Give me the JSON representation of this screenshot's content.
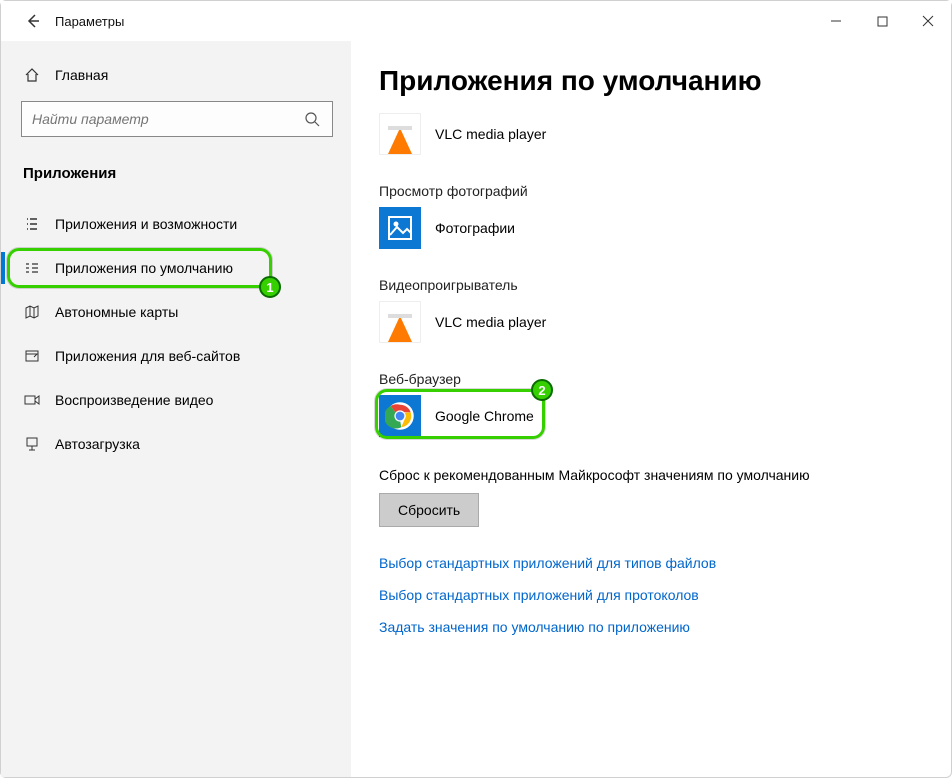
{
  "titlebar": {
    "title": "Параметры"
  },
  "sidebar": {
    "home": "Главная",
    "search_placeholder": "Найти параметр",
    "section": "Приложения",
    "items": [
      {
        "label": "Приложения и возможности"
      },
      {
        "label": "Приложения по умолчанию"
      },
      {
        "label": "Автономные карты"
      },
      {
        "label": "Приложения для веб-сайтов"
      },
      {
        "label": "Воспроизведение видео"
      },
      {
        "label": "Автозагрузка"
      }
    ]
  },
  "main": {
    "heading": "Приложения по умолчанию",
    "defaults": [
      {
        "category": "",
        "app": "VLC media player",
        "icon": "vlc"
      },
      {
        "category": "Просмотр фотографий",
        "app": "Фотографии",
        "icon": "photos"
      },
      {
        "category": "Видеопроигрыватель",
        "app": "VLC media player",
        "icon": "vlc"
      },
      {
        "category": "Веб-браузер",
        "app": "Google Chrome",
        "icon": "chrome"
      }
    ],
    "reset": {
      "label": "Сброс к рекомендованным Майкрософт значениям по умолчанию",
      "button": "Сбросить"
    },
    "links": [
      "Выбор стандартных приложений для типов файлов",
      "Выбор стандартных приложений для протоколов",
      "Задать значения по умолчанию по приложению"
    ]
  },
  "annotations": {
    "badge1": "1",
    "badge2": "2"
  }
}
